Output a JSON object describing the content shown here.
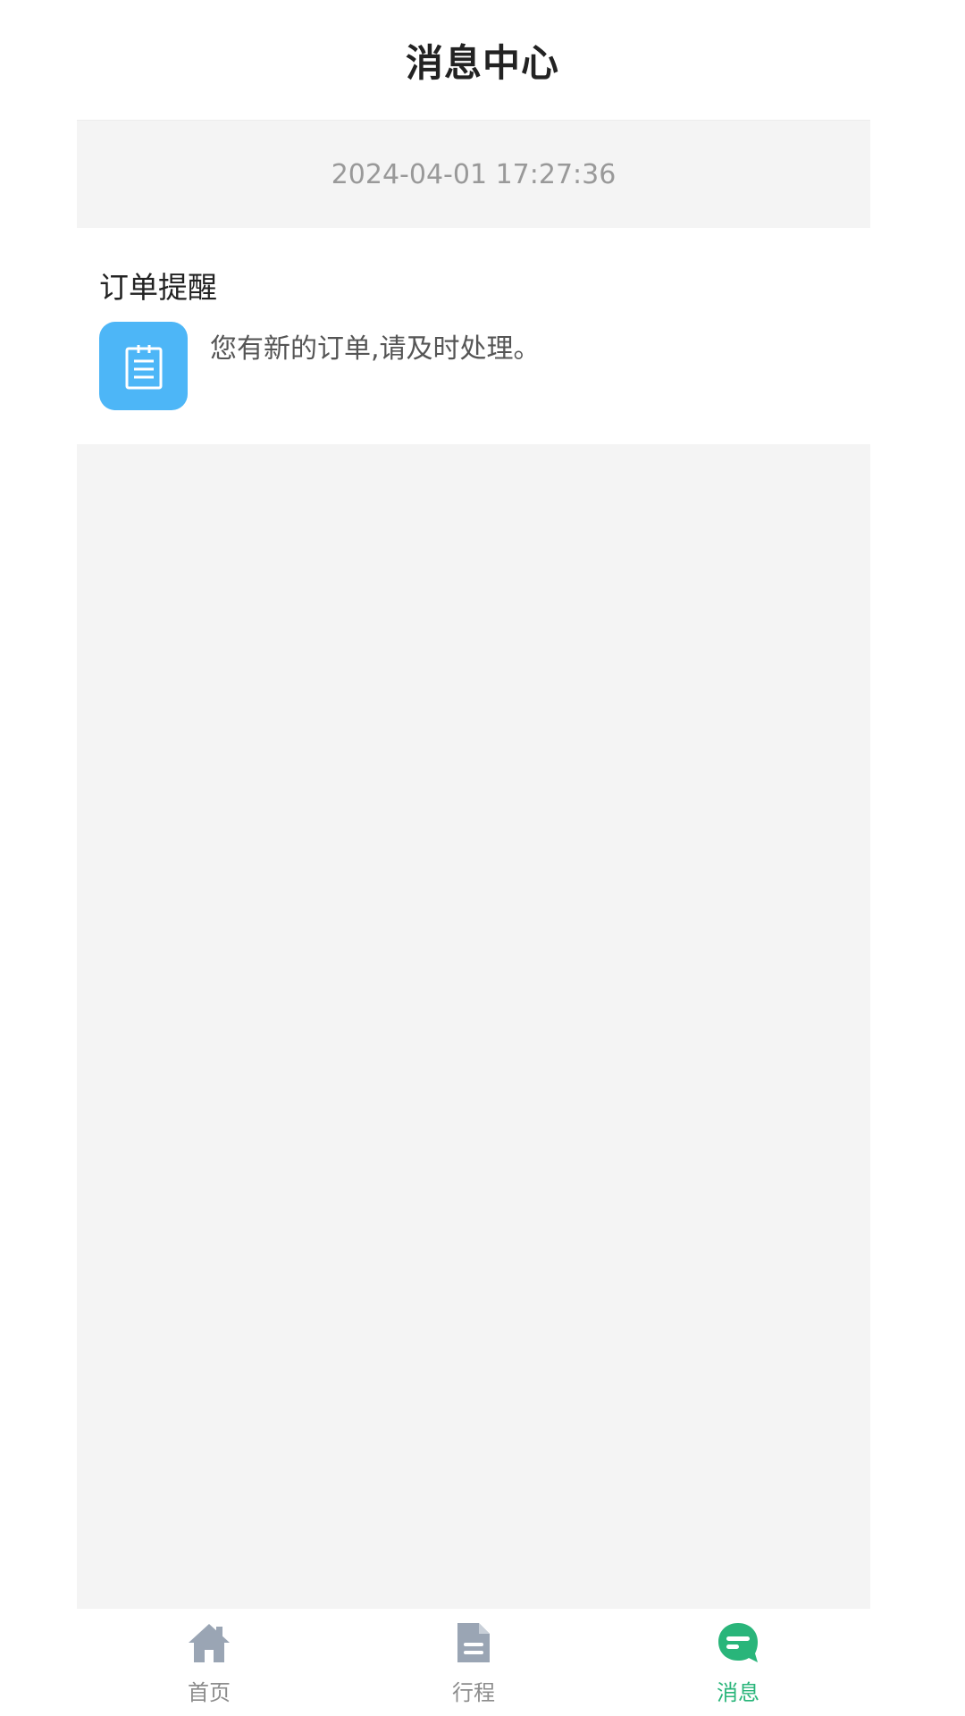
{
  "header": {
    "title": "消息中心"
  },
  "messages": [
    {
      "timestamp": "2024-04-01 17:27:36",
      "title": "订单提醒",
      "icon": "order-clipboard-icon",
      "text": "您有新的订单,请及时处理。"
    }
  ],
  "tabbar": {
    "items": [
      {
        "label": "首页",
        "icon": "home-icon",
        "active": false
      },
      {
        "label": "行程",
        "icon": "document-icon",
        "active": false
      },
      {
        "label": "消息",
        "icon": "message-icon",
        "active": true
      }
    ]
  },
  "colors": {
    "accent": "#29b57a",
    "inactive": "#9aa5b4",
    "icon_bg": "#4db6f7",
    "page_bg": "#f4f4f4"
  }
}
